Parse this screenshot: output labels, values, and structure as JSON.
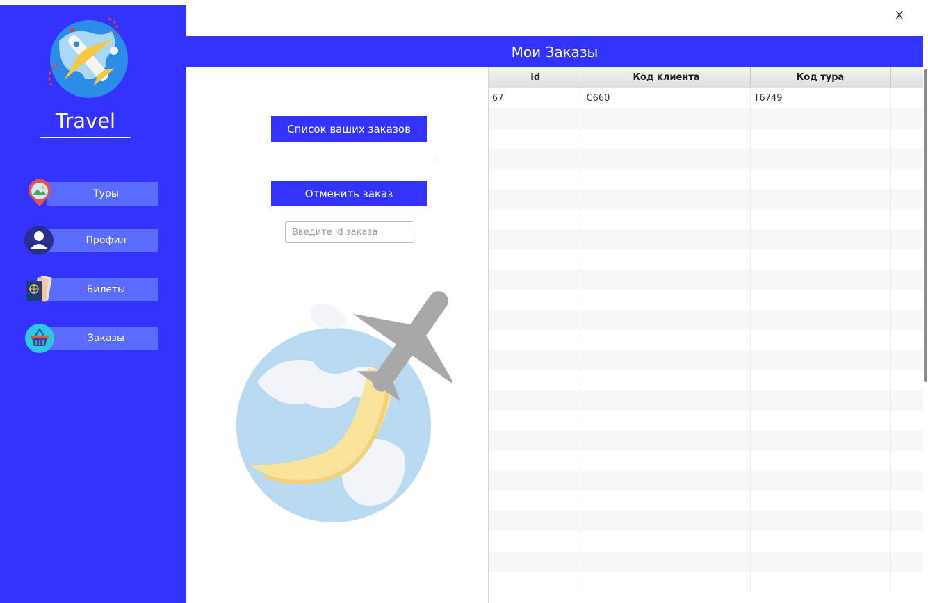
{
  "app": {
    "brand": "Travel",
    "close_label": "X"
  },
  "sidebar": {
    "items": [
      {
        "label": "Туры",
        "icon": "map-pin-landscape-icon"
      },
      {
        "label": "Профил",
        "icon": "user-avatar-icon"
      },
      {
        "label": "Билеты",
        "icon": "passport-tickets-icon"
      },
      {
        "label": "Заказы",
        "icon": "shopping-basket-icon"
      }
    ]
  },
  "main": {
    "title": "Мои Заказы",
    "list_button": "Список ваших заказов",
    "cancel_button": "Отменить заказ",
    "order_id_input": {
      "placeholder": "Введите id заказа",
      "value": ""
    }
  },
  "table": {
    "columns": [
      "id",
      "Код клиента",
      "Код тура"
    ],
    "rows": [
      [
        "67",
        "C660",
        "T6749"
      ]
    ]
  },
  "colors": {
    "accent": "#3333ff",
    "nav_button": "#5c6bff"
  }
}
